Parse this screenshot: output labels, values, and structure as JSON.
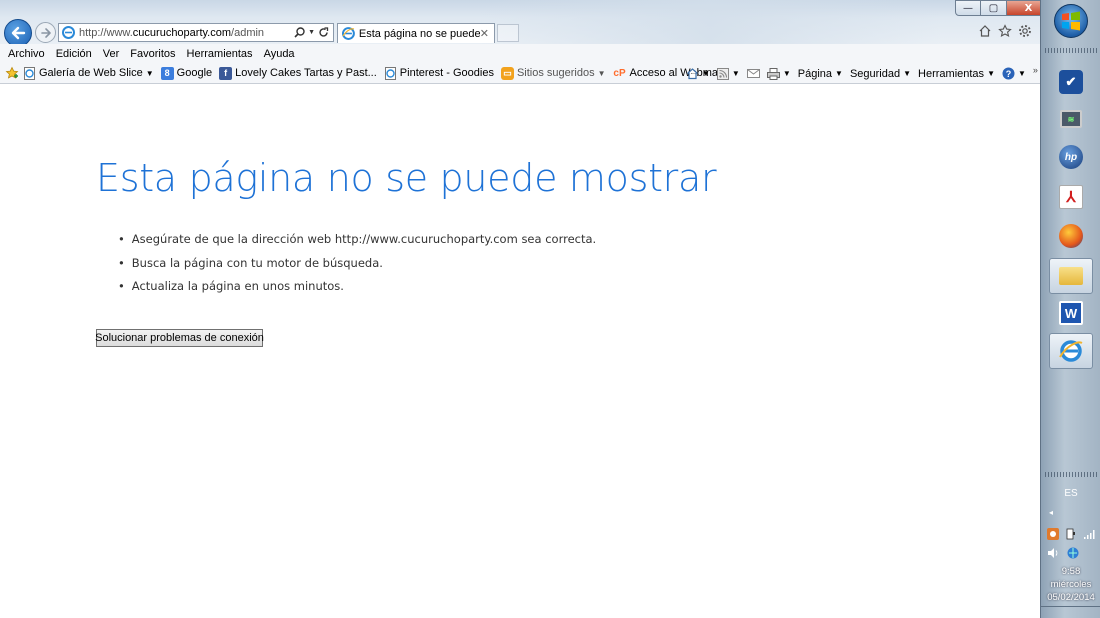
{
  "browser": {
    "address": {
      "prefix": "http://www.",
      "domain": "cucuruchoparty.com",
      "suffix": "/admin"
    },
    "tab": {
      "title": "Esta página no se puede m...",
      "close_glyph": "✕"
    },
    "window_controls": {
      "minimize": "—",
      "maximize": "▢",
      "close": "X"
    },
    "menu": [
      "Archivo",
      "Edición",
      "Ver",
      "Favoritos",
      "Herramientas",
      "Ayuda"
    ],
    "favorites": [
      {
        "label": "Galería de Web Slice",
        "icon": "ie-page-icon",
        "dropdown": true,
        "muted": false
      },
      {
        "label": "Google",
        "icon": "google-icon",
        "dropdown": false,
        "muted": false
      },
      {
        "label": "Lovely Cakes Tartas y Past...",
        "icon": "facebook-icon",
        "dropdown": false,
        "muted": false
      },
      {
        "label": "Pinterest - Goodies",
        "icon": "ie-page-icon",
        "dropdown": false,
        "muted": false
      },
      {
        "label": "Sitios sugeridos",
        "icon": "suggested-sites-icon",
        "dropdown": true,
        "muted": true
      },
      {
        "label": "Acceso al Webmail",
        "icon": "cpanel-icon",
        "dropdown": false,
        "muted": false
      }
    ],
    "commands": [
      {
        "label": "Página",
        "dropdown": true
      },
      {
        "label": "Seguridad",
        "dropdown": true
      },
      {
        "label": "Herramientas",
        "dropdown": true
      }
    ],
    "colors": {
      "accent": "#1e72d6",
      "favorites_google": "#3b7ddd",
      "favorites_facebook": "#3b5998",
      "favorites_cp": "#ff6c2c",
      "close_button": "#c7442a"
    }
  },
  "page": {
    "title": "Esta página no se puede mostrar",
    "tips": [
      "Asegúrate de que la dirección web http://www.cucuruchoparty.com sea correcta.",
      "Busca la página con tu motor de búsqueda.",
      "Actualiza la página en unos minutos."
    ],
    "fix_button": "Solucionar problemas de conexión"
  },
  "taskbar": {
    "pinned": [
      {
        "name": "task-check-icon",
        "active": false
      },
      {
        "name": "monitor-icon",
        "active": false
      },
      {
        "name": "hp-icon",
        "active": false
      },
      {
        "name": "adobe-reader-icon",
        "active": false
      },
      {
        "name": "firefox-icon",
        "active": false
      },
      {
        "name": "file-explorer-icon",
        "active": true
      },
      {
        "name": "word-icon",
        "active": false
      },
      {
        "name": "internet-explorer-icon",
        "active": true
      }
    ],
    "language": "ES",
    "tray_arrow": "◂",
    "clock": {
      "time": "9:58",
      "day": "miércoles",
      "date": "05/02/2014"
    }
  }
}
